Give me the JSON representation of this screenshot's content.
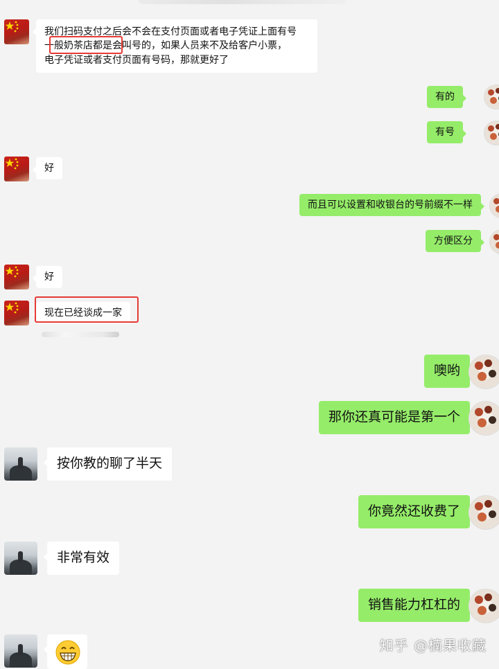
{
  "watermark": "知乎 @楠果收藏",
  "messages": [
    {
      "side": "left",
      "avatar": "flag-avatar",
      "lines": [
        "我们扫码支付之后会不会在支付页面或者电子凭证上面有号",
        "一般奶茶店都是会叫号的，如果人员来不及给客户小票，",
        "电子凭证或者支付页面有号码，那就更好了"
      ]
    },
    {
      "side": "right",
      "avatar": "food-avatar",
      "text": "有的"
    },
    {
      "side": "right",
      "avatar": "food-avatar",
      "text": "有号"
    },
    {
      "side": "left",
      "avatar": "flag-avatar",
      "text": "好"
    },
    {
      "side": "right",
      "avatar": "food-avatar",
      "text": "而且可以设置和收银台的号前缀不一样"
    },
    {
      "side": "right",
      "avatar": "food-avatar",
      "text": "方便区分"
    },
    {
      "side": "left",
      "avatar": "flag-avatar",
      "text": "好"
    },
    {
      "side": "left",
      "avatar": "flag-avatar",
      "text": "现在已经谈成一家"
    },
    {
      "side": "right",
      "avatar": "food-avatar",
      "text": "噢哟"
    },
    {
      "side": "right",
      "avatar": "food-avatar",
      "text": "那你还真可能是第一个"
    },
    {
      "side": "left",
      "avatar": "mountain-avatar",
      "text": "按你教的聊了半天"
    },
    {
      "side": "right",
      "avatar": "food-avatar",
      "text": "你竟然还收费了"
    },
    {
      "side": "left",
      "avatar": "mountain-avatar",
      "text": "非常有效"
    },
    {
      "side": "right",
      "avatar": "food-avatar",
      "text": "销售能力杠杠的"
    },
    {
      "side": "left",
      "avatar": "mountain-avatar",
      "emoji": "grinning-face-emoji"
    }
  ],
  "colors": {
    "background": "#f3f3f3",
    "my_bubble": "#95ec69",
    "their_bubble": "#ffffff",
    "highlight_box": "#e53935"
  }
}
